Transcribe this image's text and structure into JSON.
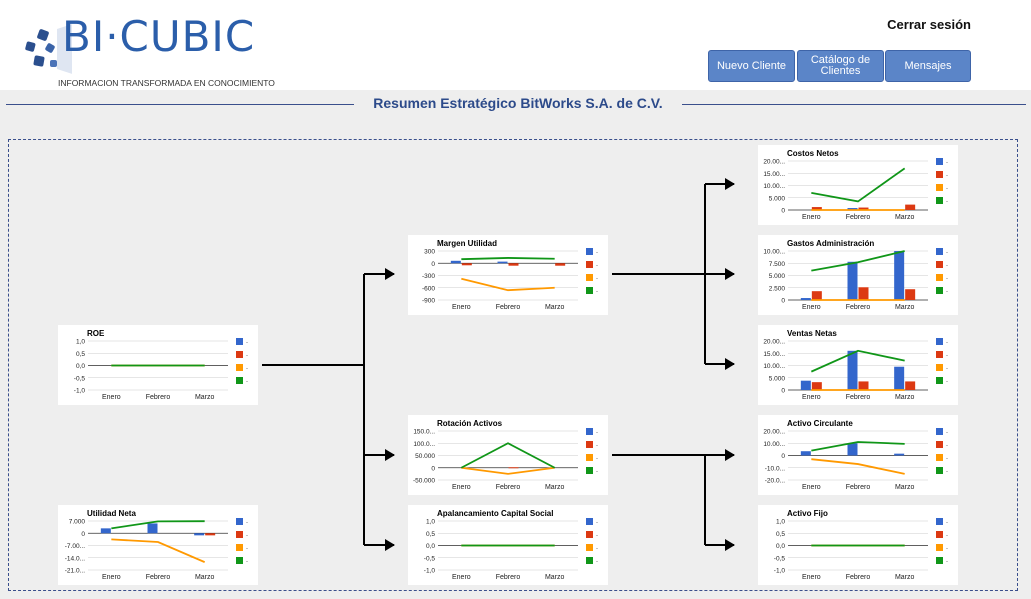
{
  "header": {
    "logo_text": "BI·CUBIC",
    "logo_tagline": "INFORMACION TRANSFORMADA EN CONOCIMIENTO",
    "logout_label": "Cerrar sesión",
    "buttons": [
      {
        "label": "Nuevo Cliente"
      },
      {
        "label": "Catálogo de Clientes"
      },
      {
        "label": "Mensajes"
      }
    ]
  },
  "page_title": "Resumen Estratégico BitWorks S.A. de C.V.",
  "colors": {
    "series": [
      "#3366cc",
      "#dc3912",
      "#ff9900",
      "#109618"
    ],
    "title": "#2c4a8a",
    "button": "#5b85c8"
  },
  "chart_data": [
    {
      "id": "roe",
      "type": "bar+line",
      "title": "ROE",
      "categories": [
        "Enero",
        "Febrero",
        "Marzo"
      ],
      "y_ticks": [
        "1,0",
        "0,5",
        "0,0",
        "-0,5",
        "-1,0"
      ],
      "ylim": [
        -1,
        1
      ],
      "series": [
        {
          "name": "-",
          "kind": "bar",
          "values": [
            0,
            0,
            0
          ]
        },
        {
          "name": "-",
          "kind": "bar",
          "values": [
            0,
            0,
            0
          ]
        },
        {
          "name": "-",
          "kind": "line",
          "values": [
            0,
            0,
            0
          ]
        },
        {
          "name": "-",
          "kind": "line",
          "values": [
            0,
            0,
            0
          ]
        }
      ]
    },
    {
      "id": "utilidad_neta",
      "type": "bar+line",
      "title": "Utilidad Neta",
      "categories": [
        "Enero",
        "Febrero",
        "Marzo"
      ],
      "y_ticks": [
        "7.000",
        "0",
        "-7.00...",
        "-14.0...",
        "-21.0..."
      ],
      "ylim": [
        -21000,
        7000
      ],
      "series": [
        {
          "name": "-",
          "kind": "bar",
          "values": [
            2800,
            5600,
            -1200
          ]
        },
        {
          "name": "-",
          "kind": "bar",
          "values": [
            0,
            0,
            -1200
          ]
        },
        {
          "name": "-",
          "kind": "line",
          "values": [
            -3500,
            -5000,
            -16500
          ]
        },
        {
          "name": "-",
          "kind": "line",
          "values": [
            2800,
            6800,
            6900
          ]
        }
      ]
    },
    {
      "id": "margen_utilidad",
      "type": "bar+line",
      "title": "Margen Utilidad",
      "categories": [
        "Enero",
        "Febrero",
        "Marzo"
      ],
      "y_ticks": [
        "300",
        "0",
        "-300",
        "-600",
        "-900"
      ],
      "ylim": [
        -900,
        300
      ],
      "series": [
        {
          "name": "-",
          "kind": "bar",
          "values": [
            60,
            40,
            0
          ]
        },
        {
          "name": "-",
          "kind": "bar",
          "values": [
            -50,
            -60,
            -60
          ]
        },
        {
          "name": "-",
          "kind": "line",
          "values": [
            -380,
            -660,
            -600
          ]
        },
        {
          "name": "-",
          "kind": "line",
          "values": [
            100,
            130,
            110
          ]
        }
      ]
    },
    {
      "id": "rotacion_activos",
      "type": "bar+line",
      "title": "Rotación Activos",
      "categories": [
        "Enero",
        "Febrero",
        "Marzo"
      ],
      "y_ticks": [
        "150.0...",
        "100.0...",
        "50.000",
        "0",
        "-50.000"
      ],
      "ylim": [
        -50000,
        150000
      ],
      "series": [
        {
          "name": "-",
          "kind": "bar",
          "values": [
            0,
            0,
            0
          ]
        },
        {
          "name": "-",
          "kind": "bar",
          "values": [
            0,
            2000,
            0
          ]
        },
        {
          "name": "-",
          "kind": "line",
          "values": [
            0,
            -25000,
            0
          ]
        },
        {
          "name": "-",
          "kind": "line",
          "values": [
            0,
            100000,
            0
          ]
        }
      ]
    },
    {
      "id": "apalancamiento",
      "type": "bar+line",
      "title": "Apalancamiento Capital Social",
      "categories": [
        "Enero",
        "Febrero",
        "Marzo"
      ],
      "y_ticks": [
        "1,0",
        "0,5",
        "0,0",
        "-0,5",
        "-1,0"
      ],
      "ylim": [
        -1,
        1
      ],
      "series": [
        {
          "name": "-",
          "kind": "bar",
          "values": [
            0,
            0,
            0
          ]
        },
        {
          "name": "-",
          "kind": "bar",
          "values": [
            0,
            0,
            0
          ]
        },
        {
          "name": "-",
          "kind": "line",
          "values": [
            0,
            0,
            0
          ]
        },
        {
          "name": "-",
          "kind": "line",
          "values": [
            0,
            0,
            0
          ]
        }
      ]
    },
    {
      "id": "costos_netos",
      "type": "bar+line",
      "title": "Costos Netos",
      "categories": [
        "Enero",
        "Febrero",
        "Marzo"
      ],
      "y_ticks": [
        "20.00...",
        "15.00...",
        "10.00...",
        "5.000",
        "0"
      ],
      "ylim": [
        0,
        20000
      ],
      "series": [
        {
          "name": "-",
          "kind": "bar",
          "values": [
            0,
            800,
            0
          ]
        },
        {
          "name": "-",
          "kind": "bar",
          "values": [
            1200,
            1000,
            2200
          ]
        },
        {
          "name": "-",
          "kind": "line",
          "values": [
            0,
            0,
            0
          ]
        },
        {
          "name": "-",
          "kind": "line",
          "values": [
            7000,
            3500,
            17000
          ]
        }
      ]
    },
    {
      "id": "gastos_administracion",
      "type": "bar+line",
      "title": "Gastos Administración",
      "categories": [
        "Enero",
        "Febrero",
        "Marzo"
      ],
      "y_ticks": [
        "10.00...",
        "7.500",
        "5.000",
        "2.500",
        "0"
      ],
      "ylim": [
        0,
        10000
      ],
      "series": [
        {
          "name": "-",
          "kind": "bar",
          "values": [
            400,
            7800,
            10000
          ]
        },
        {
          "name": "-",
          "kind": "bar",
          "values": [
            1800,
            2600,
            2200
          ]
        },
        {
          "name": "-",
          "kind": "line",
          "values": [
            0,
            0,
            0
          ]
        },
        {
          "name": "-",
          "kind": "line",
          "values": [
            6000,
            7700,
            10000
          ]
        }
      ]
    },
    {
      "id": "ventas_netas",
      "type": "bar+line",
      "title": "Ventas Netas",
      "categories": [
        "Enero",
        "Febrero",
        "Marzo"
      ],
      "y_ticks": [
        "20.00...",
        "15.00...",
        "10.00...",
        "5.000",
        "0"
      ],
      "ylim": [
        0,
        20000
      ],
      "series": [
        {
          "name": "-",
          "kind": "bar",
          "values": [
            3800,
            16000,
            9500
          ]
        },
        {
          "name": "-",
          "kind": "bar",
          "values": [
            3200,
            3500,
            3500
          ]
        },
        {
          "name": "-",
          "kind": "line",
          "values": [
            0,
            0,
            0
          ]
        },
        {
          "name": "-",
          "kind": "line",
          "values": [
            7500,
            16000,
            12000
          ]
        }
      ]
    },
    {
      "id": "activo_circulante",
      "type": "bar+line",
      "title": "Activo Circulante",
      "categories": [
        "Enero",
        "Febrero",
        "Marzo"
      ],
      "y_ticks": [
        "20.00...",
        "10.00...",
        "0",
        "-10.0...",
        "-20.0..."
      ],
      "ylim": [
        -20000,
        20000
      ],
      "series": [
        {
          "name": "-",
          "kind": "bar",
          "values": [
            3500,
            10000,
            1500
          ]
        },
        {
          "name": "-",
          "kind": "bar",
          "values": [
            0,
            0,
            0
          ]
        },
        {
          "name": "-",
          "kind": "line",
          "values": [
            -3000,
            -7000,
            -15000
          ]
        },
        {
          "name": "-",
          "kind": "line",
          "values": [
            4000,
            11000,
            9500
          ]
        }
      ]
    },
    {
      "id": "activo_fijo",
      "type": "bar+line",
      "title": "Activo Fijo",
      "categories": [
        "Enero",
        "Febrero",
        "Marzo"
      ],
      "y_ticks": [
        "1,0",
        "0,5",
        "0,0",
        "-0,5",
        "-1,0"
      ],
      "ylim": [
        -1,
        1
      ],
      "series": [
        {
          "name": "-",
          "kind": "bar",
          "values": [
            0,
            0,
            0
          ]
        },
        {
          "name": "-",
          "kind": "bar",
          "values": [
            0,
            0,
            0
          ]
        },
        {
          "name": "-",
          "kind": "line",
          "values": [
            0,
            0,
            0
          ]
        },
        {
          "name": "-",
          "kind": "line",
          "values": [
            0,
            0,
            0
          ]
        }
      ]
    }
  ]
}
